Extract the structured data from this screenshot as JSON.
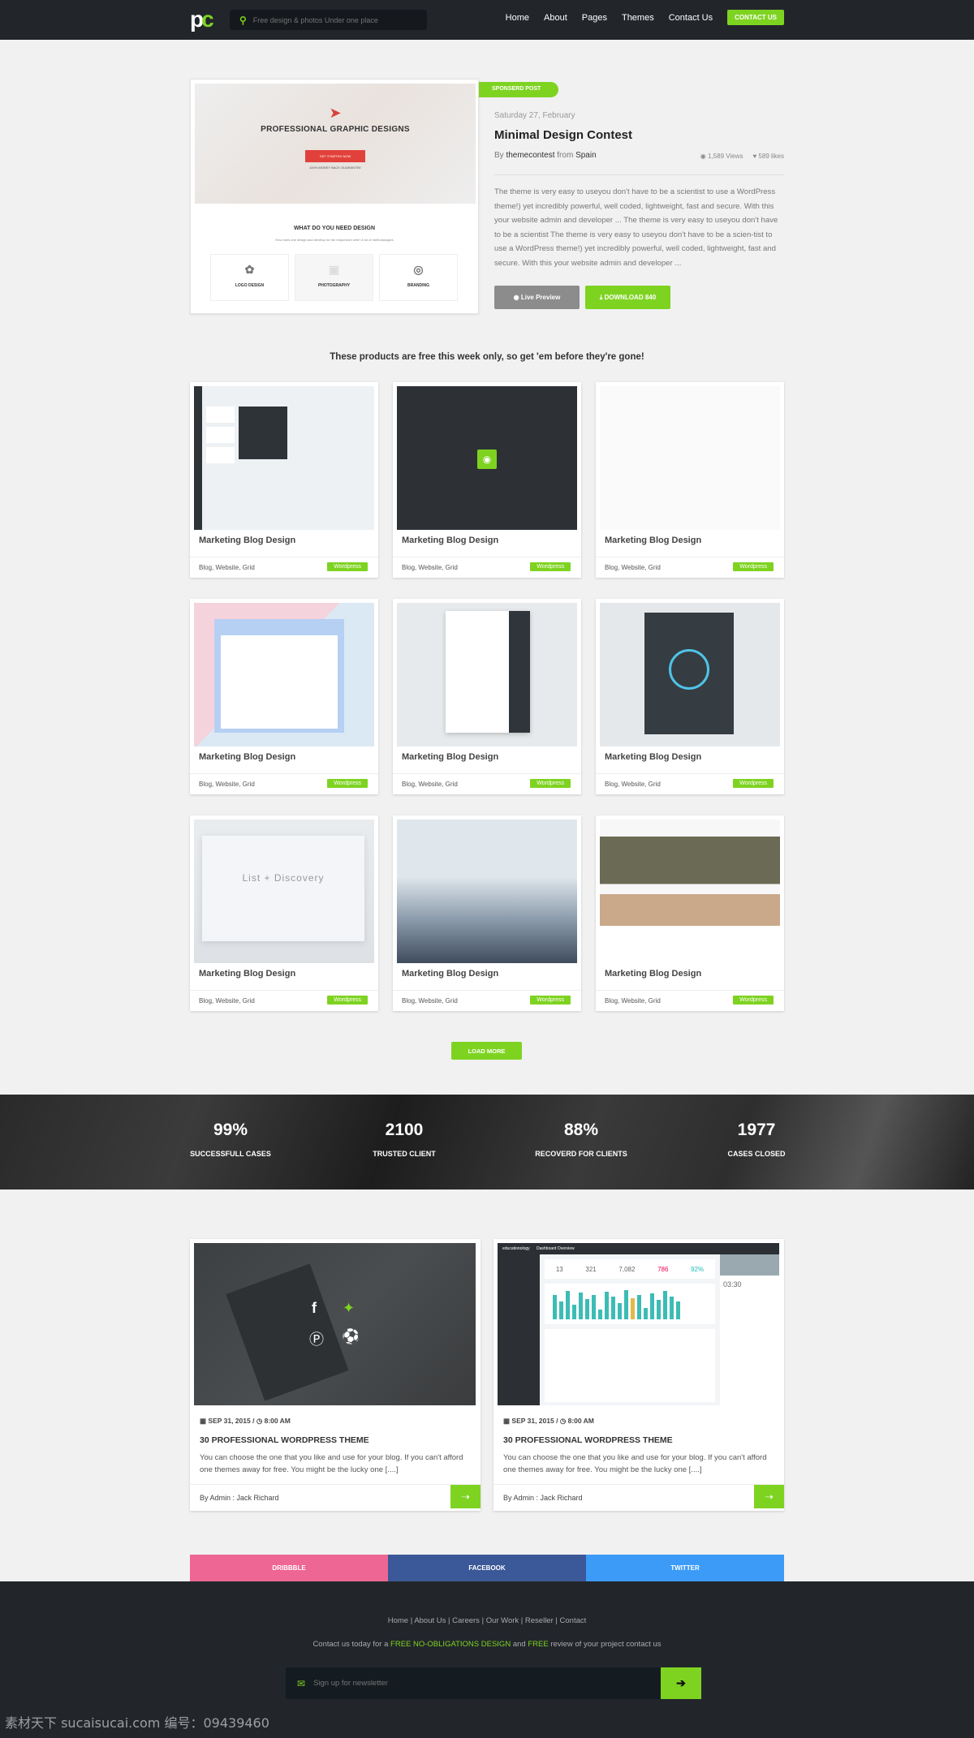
{
  "nav": {
    "logo": "pc",
    "search_placeholder": "Free design & photos Under one place",
    "links": [
      "Home",
      "About",
      "Pages",
      "Themes",
      "Contact Us"
    ],
    "cta": "CONTACT US"
  },
  "featured": {
    "preview": {
      "heading": "PROFESSIONAL GRAPHIC DESIGNS",
      "button": "GET STARTED NOW",
      "guarantee": "100% MONEY BACK GUARANTEE",
      "section_title": "WHAT DO YOU NEED DESIGN",
      "section_sub": "How does one design and develop for the responsive web? A lot of methodologies",
      "services": [
        "LOGO DESIGN",
        "PHOTOGRAPHY",
        "BRANDING"
      ]
    },
    "badge": "SPONSERD POST",
    "date": "Saturday 27, February",
    "title": "Minimal Design Contest",
    "by": "By",
    "author": "themecontest",
    "from": "from",
    "location": "Spain",
    "views": "1,589 Views",
    "likes": "589 likes",
    "description": "The theme is very easy to useyou don't have to be a scientist to use a WordPress theme!) yet incredibly powerful, well coded, lightweight, fast and secure. With this your website admin and developer ... The theme is very easy to useyou don't have to be a scientist The theme is very easy to useyou don't have to be a scien-tist to use a WordPress theme!) yet incredibly powerful, well coded, lightweight, fast and secure. With this your website admin and developer ...",
    "live_preview": "Live Preview",
    "download": "DOWNLOAD 840"
  },
  "headline": "These products are free this week only, so get 'em before they're gone!",
  "products": [
    {
      "title": "Marketing Blog Design",
      "tags": "Blog, Website, Grid",
      "badge": "Wordpress"
    },
    {
      "title": "Marketing Blog Design",
      "tags": "Blog, Website, Grid",
      "badge": "Wordpress"
    },
    {
      "title": "Marketing Blog Design",
      "tags": "Blog, Website, Grid",
      "badge": "Wordpress"
    },
    {
      "title": "Marketing Blog Design",
      "tags": "Blog, Website, Grid",
      "badge": "Wordpress"
    },
    {
      "title": "Marketing Blog Design",
      "tags": "Blog, Website, Grid",
      "badge": "Wordpress"
    },
    {
      "title": "Marketing Blog Design",
      "tags": "Blog, Website, Grid",
      "badge": "Wordpress"
    },
    {
      "title": "Marketing Blog Design",
      "tags": "Blog, Website, Grid",
      "badge": "Wordpress"
    },
    {
      "title": "Marketing Blog Design",
      "tags": "Blog, Website, Grid",
      "badge": "Wordpress"
    },
    {
      "title": "Marketing Blog Design",
      "tags": "Blog, Website, Grid",
      "badge": "Wordpress"
    }
  ],
  "load_more": "LOAD MORE",
  "stats": [
    {
      "value": "99%",
      "label": "SUCCESSFULL CASES"
    },
    {
      "value": "2100",
      "label": "TRUSTED CLIENT"
    },
    {
      "value": "88%",
      "label": "RECOVERD FOR CLIENTS"
    },
    {
      "value": "1977",
      "label": "CASES CLOSED"
    }
  ],
  "posts": [
    {
      "date": "SEP 31, 2015",
      "time": "8:00 AM",
      "title": "30 PROFESSIONAL WORDPRESS THEME",
      "excerpt": "You can choose the one that you like and use for your blog. If you can't afford one themes away for free. You might be the lucky one [....]",
      "author": "By Admin : Jack Richard"
    },
    {
      "date": "SEP 31, 2015",
      "time": "8:00 AM",
      "title": "30 PROFESSIONAL WORDPRESS THEME",
      "excerpt": "You can choose the one that you like and use for your blog. If you can't afford one themes away for free. You might be the lucky one [....]",
      "author": "By Admin : Jack Richard",
      "preview": {
        "brand": "educationology",
        "header": "Dashboard Overview",
        "numbers": [
          "13",
          "321",
          "7,082",
          "786",
          "92%"
        ],
        "time": "03:30"
      }
    }
  ],
  "social": [
    {
      "label": "DRIBBBLE",
      "color": "#ee6693"
    },
    {
      "label": "FACEBOOK",
      "color": "#3b5998"
    },
    {
      "label": "TWITTER",
      "color": "#3d9bf8"
    }
  ],
  "footer": {
    "links": [
      "Home",
      "About Us",
      "Careers",
      "Our Work",
      "Reseller",
      "Contact"
    ],
    "contact_pre": "Contact us today for a",
    "contact_hl1": "FREE NO-OBLIGATIONS DESIGN",
    "contact_mid": "and",
    "contact_hl2": "FREE",
    "contact_post": "review of your project contact us",
    "newsletter_placeholder": "Sign up for newsletter"
  },
  "watermark": "素材天下 sucaisucai.com  编号：09439460",
  "colors": {
    "accent": "#7ed321",
    "nav_bg": "#22262b",
    "page_bg": "#f1f1f1"
  }
}
